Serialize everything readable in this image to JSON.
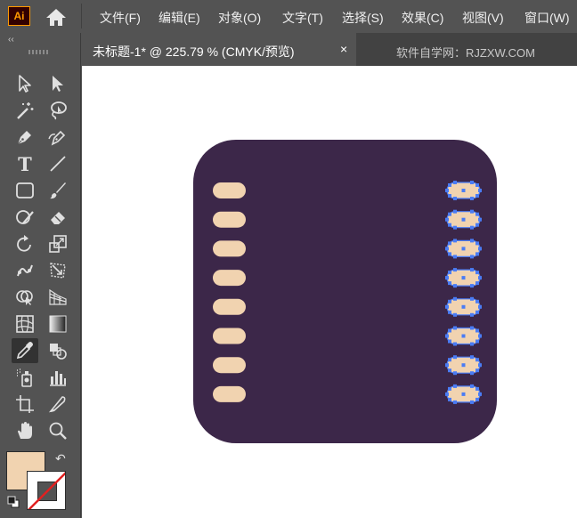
{
  "app": {
    "logo_text": "Ai"
  },
  "menu": [
    "文件(F)",
    "编辑(E)",
    "对象(O)",
    "文字(T)",
    "选择(S)",
    "效果(C)",
    "视图(V)",
    "窗口(W)"
  ],
  "document_tab": {
    "title": "未标题-1* @ 225.79 % (CMYK/预览)",
    "close": "×"
  },
  "watermark": "软件自学网：RJZXW.COM",
  "toolbar": {
    "collapse": "‹‹",
    "type_tool_label": "T",
    "swap": "↶",
    "active_tool": "eyedropper-tool",
    "tools": [
      "selection-tool",
      "direct-selection-tool",
      "magic-wand-tool",
      "lasso-tool",
      "pen-tool",
      "curvature-tool",
      "type-tool",
      "line-segment-tool",
      "rectangle-tool",
      "paintbrush-tool",
      "shaper-tool",
      "eraser-tool",
      "rotate-tool",
      "scale-tool",
      "puppet-warp-tool",
      "free-transform-tool",
      "shape-builder-tool",
      "perspective-grid-tool",
      "mesh-tool",
      "gradient-tool",
      "eyedropper-tool",
      "blend-tool",
      "symbol-sprayer-tool",
      "column-graph-tool",
      "artboard-tool",
      "slice-tool",
      "hand-tool",
      "zoom-tool"
    ]
  },
  "colors": {
    "fill": "#f1d3b0",
    "stroke": "none",
    "artwork_background": "#3c2749",
    "pill": "#f1d3b0",
    "selection": "#4a7cf5"
  },
  "artwork": {
    "left_pins": 8,
    "right_pins_selected": 8
  }
}
